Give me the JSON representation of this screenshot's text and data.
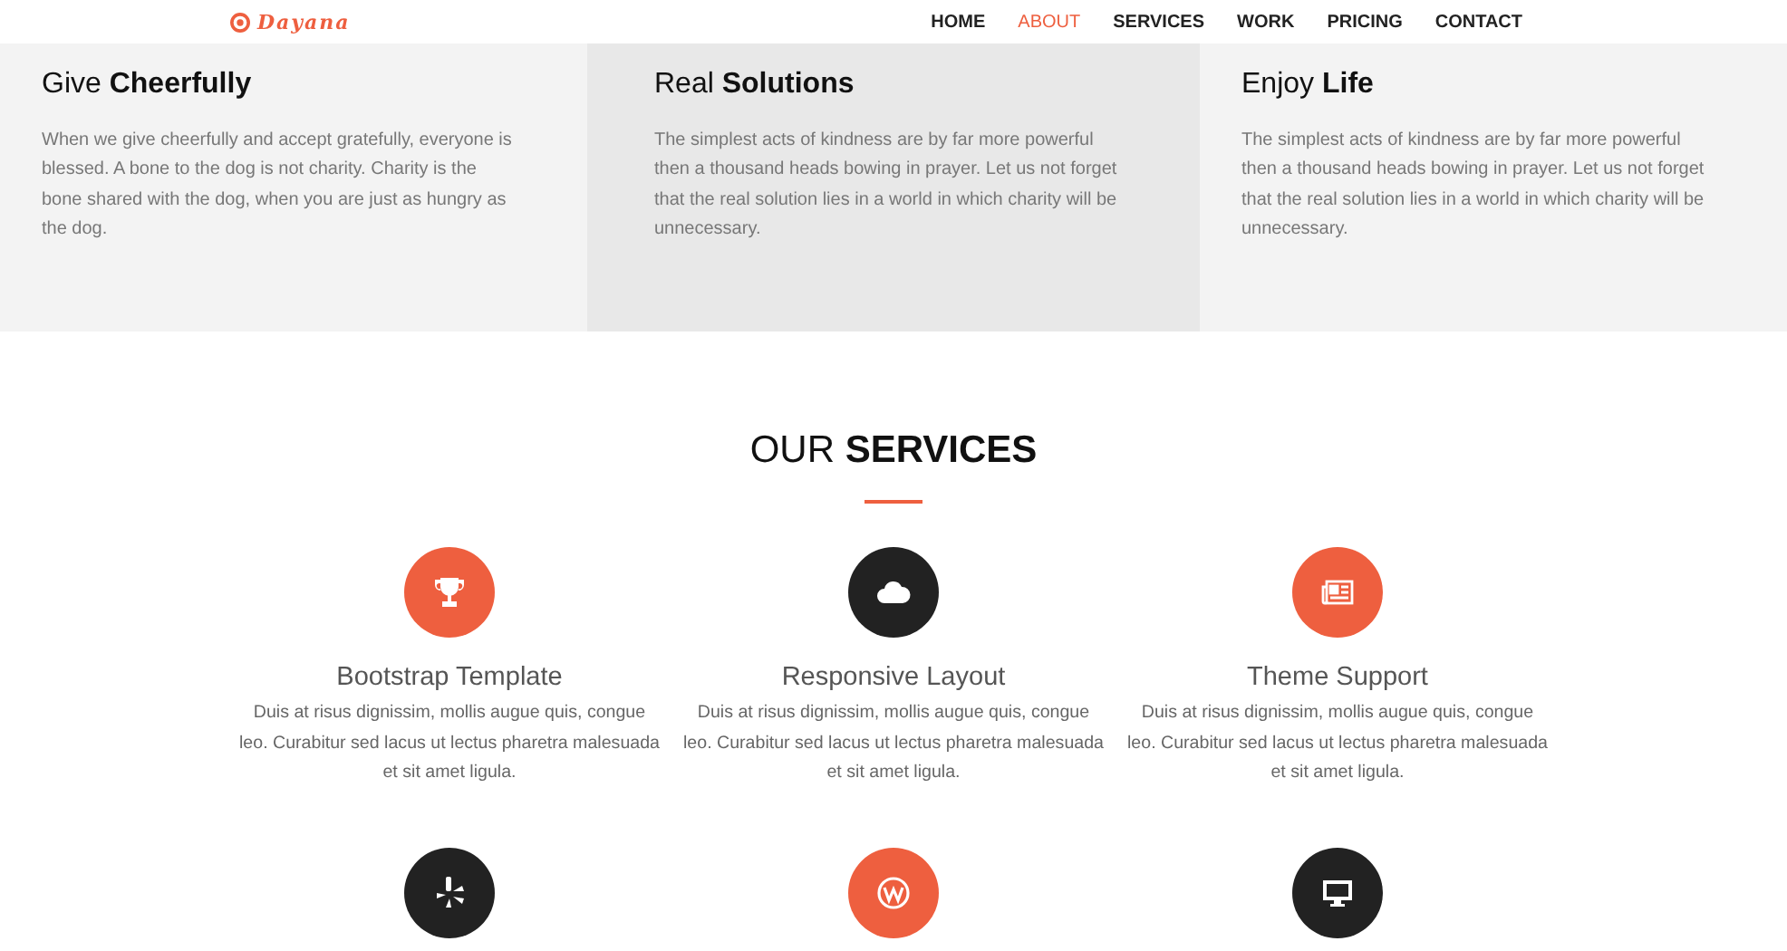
{
  "header": {
    "logo": "Dayana",
    "nav": [
      {
        "label": "HOME",
        "selected": false
      },
      {
        "label": "ABOUT",
        "selected": true
      },
      {
        "label": "SERVICES",
        "selected": false
      },
      {
        "label": "WORK",
        "selected": false
      },
      {
        "label": "PRICING",
        "selected": false
      },
      {
        "label": "CONTACT",
        "selected": false
      }
    ]
  },
  "features": [
    {
      "title": "Give **Cheerfully**",
      "text": "When we give cheerfully and accept gratefully, everyone is blessed. A bone to the dog is not charity. Charity is the bone shared with the dog, when you are just as hungry as the dog.",
      "highlighted": false
    },
    {
      "title": "Real **Solutions**",
      "text": "The simplest acts of kindness are by far more powerful then a thousand heads bowing in prayer. Let us not forget that the real solution lies in a world in which charity will be unnecessary.",
      "highlighted": true
    },
    {
      "title": "Enjoy **Life**",
      "text": "The simplest acts of kindness are by far more powerful then a thousand heads bowing in prayer. Let us not forget that the real solution lies in a world in which charity will be unnecessary.",
      "highlighted": false
    }
  ],
  "services": {
    "title": "OUR **SERVICES**",
    "items": [
      {
        "kind": "trophy",
        "color": "#ee5f3f",
        "title": "Bootstrap Template",
        "text": "Duis at risus dignissim, mollis augue quis, congue leo. Curabitur sed lacus ut lectus pharetra malesuada et sit amet ligula."
      },
      {
        "kind": "cloud",
        "color": "#222222",
        "title": "Responsive Layout",
        "text": "Duis at risus dignissim, mollis augue quis, congue leo. Curabitur sed lacus ut lectus pharetra malesuada et sit amet ligula."
      },
      {
        "kind": "newspaper",
        "color": "#ee5f3f",
        "title": "Theme Support",
        "text": "Duis at risus dignissim, mollis augue quis, congue leo. Curabitur sed lacus ut lectus pharetra malesuada et sit amet ligula."
      },
      {
        "kind": "burst",
        "color": "#222222"
      },
      {
        "kind": "zigzag",
        "color": "#ee5f3f"
      },
      {
        "kind": "monitor",
        "color": "#222222"
      }
    ]
  }
}
